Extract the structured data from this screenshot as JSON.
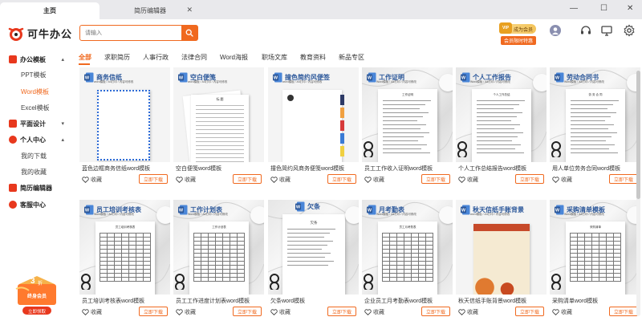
{
  "tabs": [
    {
      "label": "主页",
      "active": true
    },
    {
      "label": "简历编辑器",
      "active": false
    }
  ],
  "window_controls": {
    "minimize": "—",
    "maximize": "☐",
    "close": "✕"
  },
  "header": {
    "logo_text": "可牛办公",
    "search_placeholder": "请输入",
    "vip_badge": "VIP",
    "vip_label": "成为会员",
    "vip_promo": "会员限时特惠"
  },
  "sidebar": {
    "groups": [
      {
        "label": "办公模板",
        "expanded": true,
        "children": [
          {
            "label": "PPT模板",
            "selected": false
          },
          {
            "label": "Word模板",
            "selected": true
          },
          {
            "label": "Excel模板",
            "selected": false
          }
        ]
      },
      {
        "label": "平面设计",
        "expanded": false,
        "children": []
      },
      {
        "label": "个人中心",
        "expanded": true,
        "children": [
          {
            "label": "我的下载",
            "selected": false
          },
          {
            "label": "我的收藏",
            "selected": false
          }
        ]
      },
      {
        "label": "简历编辑器",
        "expanded": false,
        "children": []
      },
      {
        "label": "客服中心",
        "expanded": false,
        "children": []
      }
    ],
    "promo": {
      "amount": "3",
      "unit": "折",
      "title": "终身会员",
      "button": "立即领取"
    }
  },
  "categories": [
    "全部",
    "求职简历",
    "人事行政",
    "法律合同",
    "Word海报",
    "职场文库",
    "教育资料",
    "新品专区"
  ],
  "active_category": "全部",
  "card_common": {
    "fav_label": "收藏",
    "download_label": "立即下载"
  },
  "cards": [
    {
      "title": "蓝色边框商务信纸word模板",
      "thumb_heading": "商务信纸",
      "thumb_sub": "word模板 / A4打印 / 内容可修改",
      "style": "letter"
    },
    {
      "title": "空白便笺word模板",
      "thumb_heading": "空白便笺",
      "thumb_sub": "word模板 / A4打印 / 内容可修改",
      "doc_heading": "标  题",
      "style": "lined"
    },
    {
      "title": "撞色简约风商务便笺word模板",
      "thumb_heading": "撞色简约风便签",
      "thumb_sub": "word模板 / A4打印 / 内容可修改",
      "style": "tabs"
    },
    {
      "title": "员工工作收入证明word模板",
      "thumb_heading": "工作证明",
      "thumb_sub": "Word模板 / A4打印 / 内容可修改",
      "doc_heading": "工作证明",
      "style": "doc"
    },
    {
      "title": "个人工作总结报告word模板",
      "thumb_heading": "个人工作报告",
      "thumb_sub": "Word模板 / A4打印 / 内容可修改",
      "doc_heading": "个人工作总结",
      "style": "doc"
    },
    {
      "title": "用人单位劳务合同word模板",
      "thumb_heading": "劳动合同书",
      "thumb_sub": "Word模板 / A4打印 / 内容可修改",
      "doc_heading": "劳 务 合 同",
      "style": "doc"
    },
    {
      "title": "员工培训考核表word模板",
      "thumb_heading": "员工培训考核表",
      "thumb_sub": "Word模板 / A4打印 / 内容可修改",
      "doc_heading": "员工培训考核表",
      "style": "table"
    },
    {
      "title": "员工工作进度计划表word模板",
      "thumb_heading": "工作计划表",
      "thumb_sub": "Word模板 / A4打印 / 内容可修改",
      "doc_heading": "工作计划表",
      "style": "table"
    },
    {
      "title": "欠条word模板",
      "thumb_heading": "欠条",
      "thumb_sub": "",
      "doc_heading": "欠条",
      "style": "iou"
    },
    {
      "title": "企业员工月考勤表word模板",
      "thumb_heading": "月考勤表",
      "thumb_sub": "Word模板 / A4打印 / 内容可修改",
      "doc_heading": "员工月考勤表",
      "style": "table"
    },
    {
      "title": "秋天信纸手账背景word模板",
      "thumb_heading": "秋天信纸手账背景",
      "thumb_sub": "word模板 / A4打印 / 内容可修改",
      "style": "autumn"
    },
    {
      "title": "采购清单word模板",
      "thumb_heading": "采购清单模板",
      "thumb_sub": "Word模板 / A4打印 / 内容可修改",
      "doc_heading": "采购清单",
      "style": "table"
    }
  ],
  "colors": {
    "accent": "#f0691f",
    "word_blue": "#2b579a",
    "tab_bg": "#e9e9ec"
  }
}
